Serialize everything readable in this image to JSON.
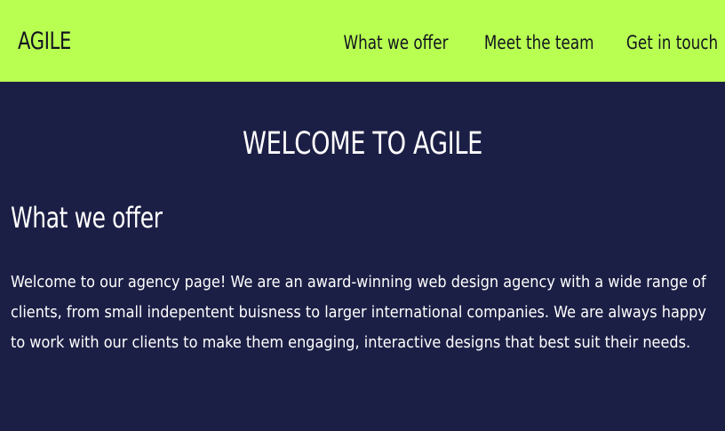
{
  "header": {
    "logo": "AGILE",
    "nav": [
      "What we offer",
      "Meet the team",
      "Get in touch"
    ],
    "background_color": "#b8ff52"
  },
  "main": {
    "title": "WELCOME TO AGILE",
    "section_title": "What we offer",
    "paragraph": "Welcome to our agency page! We are an award-winning web design agency with a wide range of clients, from small indepentent buisness to larger international companies. We are always happy to work with our clients to make them engaging, interactive designs that best suit their needs.",
    "background_color": "#1c1f45"
  }
}
